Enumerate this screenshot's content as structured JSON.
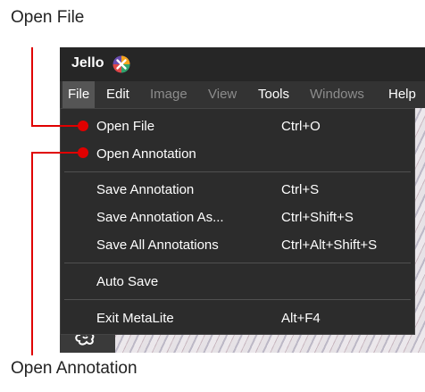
{
  "callouts": {
    "top_label": "Open File",
    "bottom_label": "Open Annotation"
  },
  "app": {
    "name": "Jello"
  },
  "menubar": {
    "items": [
      {
        "label": "File",
        "state": "active"
      },
      {
        "label": "Edit",
        "state": "enabled"
      },
      {
        "label": "Image",
        "state": "disabled"
      },
      {
        "label": "View",
        "state": "disabled"
      },
      {
        "label": "Tools",
        "state": "enabled"
      },
      {
        "label": "Windows",
        "state": "disabled"
      },
      {
        "label": "Help",
        "state": "enabled"
      }
    ]
  },
  "file_menu": {
    "open_file": {
      "label": "Open File",
      "shortcut": "Ctrl+O"
    },
    "open_annotation": {
      "label": "Open Annotation",
      "shortcut": ""
    },
    "save_annotation": {
      "label": "Save Annotation",
      "shortcut": "Ctrl+S"
    },
    "save_annotation_as": {
      "label": "Save Annotation As...",
      "shortcut": "Ctrl+Shift+S"
    },
    "save_all_annotations": {
      "label": "Save All Annotations",
      "shortcut": "Ctrl+Alt+Shift+S"
    },
    "auto_save": {
      "label": "Auto Save",
      "shortcut": ""
    },
    "exit": {
      "label": "Exit MetaLite",
      "shortcut": "Alt+F4"
    }
  },
  "colors": {
    "callout": "#e00000",
    "titlebar": "#262626",
    "menubar": "#333333",
    "dropdown": "#2c2c2c",
    "disabled_text": "#8c8c8c"
  },
  "icons": {
    "logo": "jello-x-logo-icon",
    "tool": "brain-icon"
  }
}
